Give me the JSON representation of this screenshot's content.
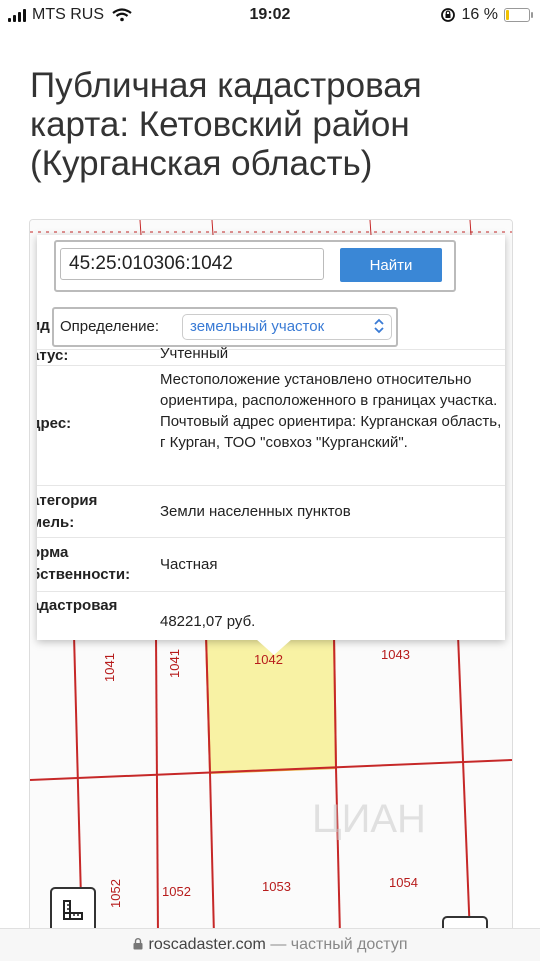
{
  "status_bar": {
    "carrier": "MTS RUS",
    "time": "19:02",
    "battery_percent": "16 %",
    "battery_level": 0.16,
    "icons": [
      "signal-icon",
      "wifi-icon",
      "orientation-lock-icon",
      "battery-icon"
    ]
  },
  "page": {
    "title": "Публичная кадастровая карта: Кетовский район (Курганская область)"
  },
  "search": {
    "cadastral_number": "45:25:010306:1042",
    "button_label": "Найти"
  },
  "definition": {
    "label": "Определение:",
    "selected": "земельный участок"
  },
  "info_rows": [
    {
      "label": "ид",
      "value": ""
    },
    {
      "label": "атус:",
      "value": "Учтенный"
    },
    {
      "label": "дрес:",
      "value": "Местоположение установлено относительно ориентира, расположенного в границах участка. Почтовый адрес ориентира: Курганская область, г Курган, ТОО \"совхоз \"Курганский\"."
    },
    {
      "label": "атегория\nмель:",
      "value": "Земли населенных пунктов"
    },
    {
      "label": "орма\nбственности:",
      "value": "Частная"
    },
    {
      "label": "адастровая",
      "value": "48221,07 руб."
    }
  ],
  "map": {
    "parcels": [
      "1041",
      "1041",
      "1042",
      "1043",
      "1052",
      "1052",
      "1053",
      "1054"
    ],
    "highlight_color": "#f8f2a4",
    "boundary_color": "#c62828",
    "watermark": "ЦИАН"
  },
  "browser": {
    "domain": "roscadaster.com",
    "suffix": "— частный доступ"
  }
}
